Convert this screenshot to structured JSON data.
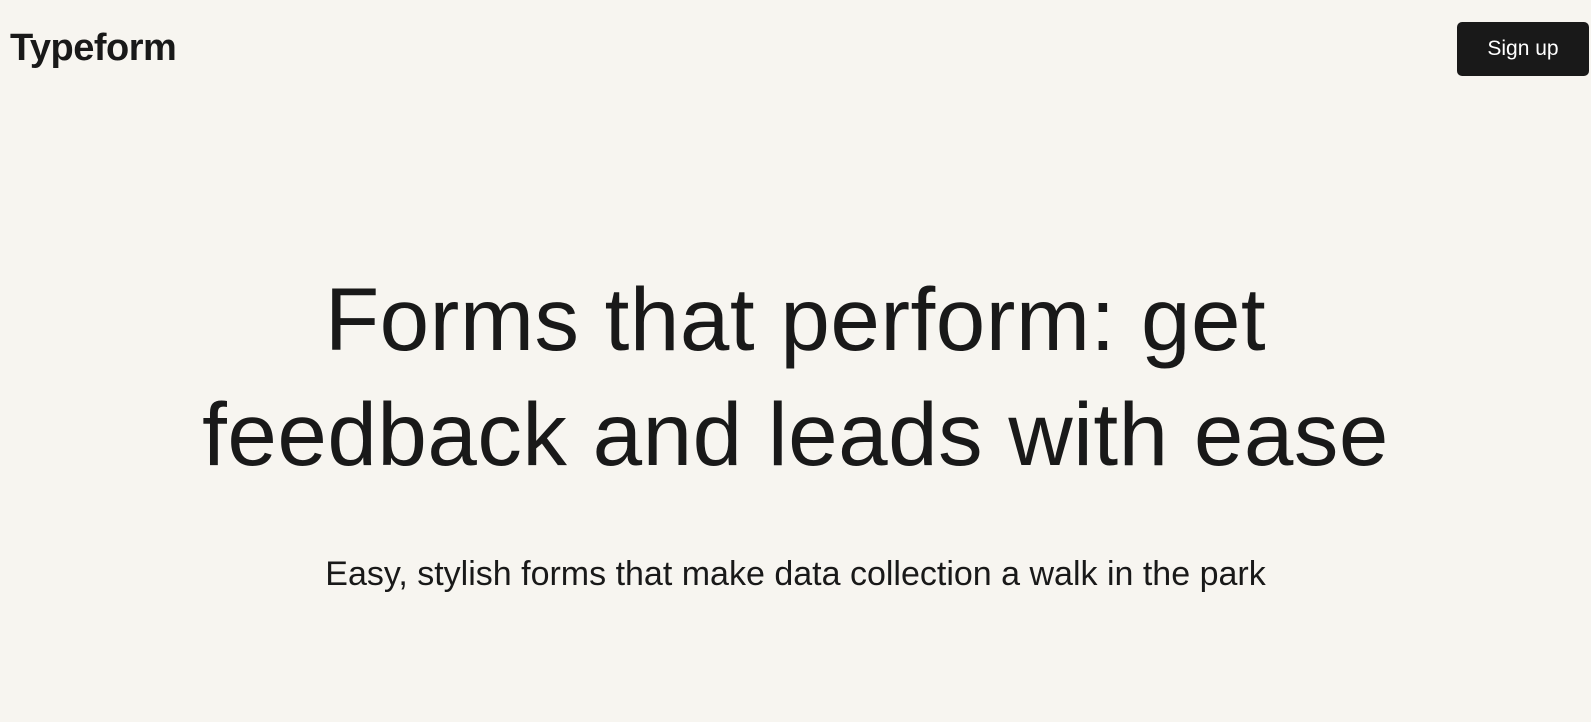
{
  "brand": {
    "name": "Typeform"
  },
  "header": {
    "signup_label": "Sign up"
  },
  "hero": {
    "headline": "Forms that perform: get feedback and leads with ease",
    "subheadline": "Easy, stylish forms that make data collection a walk in the park"
  },
  "colors": {
    "background": "#f7f5f0",
    "text": "#191919",
    "button": "#191919",
    "button_text": "#ffffff"
  }
}
